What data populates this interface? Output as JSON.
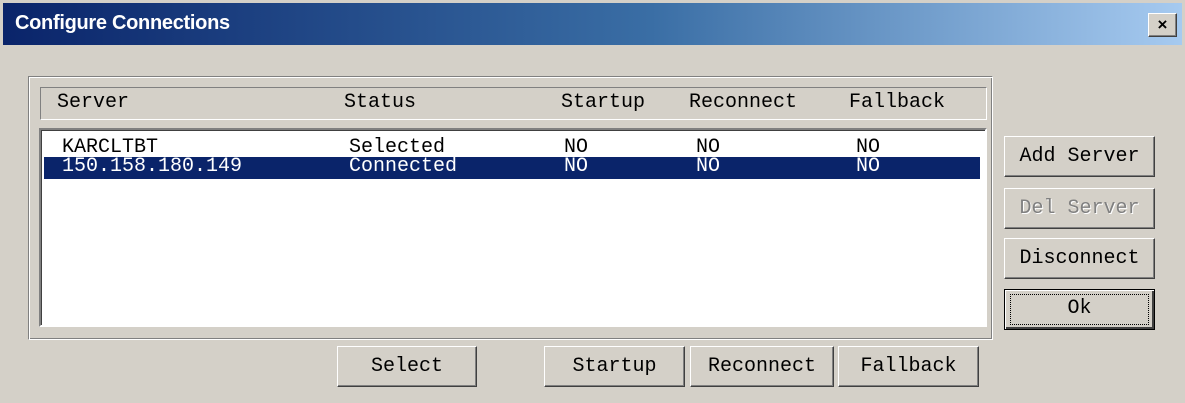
{
  "window": {
    "title": "Configure Connections",
    "close_glyph": "×"
  },
  "columns": [
    "Server",
    "Status",
    "Startup",
    "Reconnect",
    "Fallback"
  ],
  "rows": [
    {
      "server": "KARCLTBT",
      "status": "Selected",
      "startup": "NO",
      "reconnect": "NO",
      "fallback": "NO",
      "selected": false
    },
    {
      "server": "150.158.180.149",
      "status": "Connected",
      "startup": "NO",
      "reconnect": "NO",
      "fallback": "NO",
      "selected": true
    }
  ],
  "side_buttons": {
    "add_server": "Add Server",
    "del_server": "Del Server",
    "disconnect": "Disconnect",
    "ok": "Ok"
  },
  "bottom_buttons": {
    "select": "Select",
    "startup": "Startup",
    "reconnect": "Reconnect",
    "fallback": "Fallback"
  },
  "colors": {
    "selection": "#0a246a",
    "dialog_face": "#d4d0c8",
    "disabled_text": "#808080"
  }
}
